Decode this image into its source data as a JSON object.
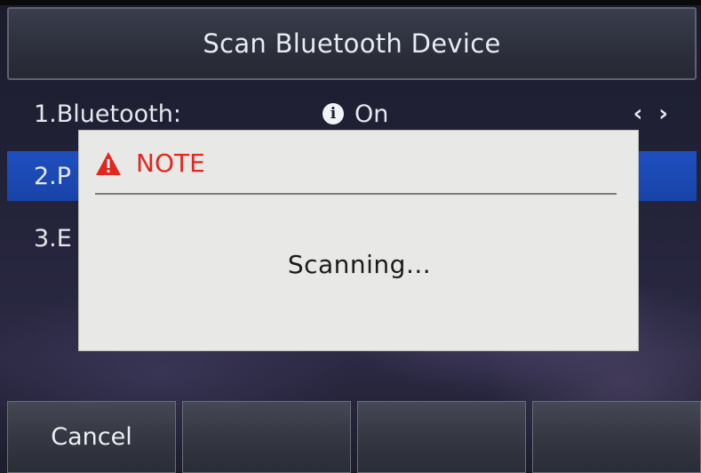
{
  "header": {
    "title": "Scan Bluetooth Device"
  },
  "list": [
    {
      "label": "1.Bluetooth:",
      "value": "On",
      "selected": false
    },
    {
      "label": "2.P",
      "selected": true
    },
    {
      "label": "3.E",
      "selected": false
    }
  ],
  "arrows": {
    "left": "‹",
    "right": "›"
  },
  "dialog": {
    "title": "NOTE",
    "message": "Scanning..."
  },
  "softkeys": [
    "Cancel",
    "",
    "",
    ""
  ],
  "colors": {
    "highlight": "#1f4fc0",
    "note_red": "#e1271f",
    "dialog_bg": "#e8e9e6"
  },
  "icons": {
    "info": "info-circle-icon",
    "warning": "warning-triangle-icon"
  }
}
